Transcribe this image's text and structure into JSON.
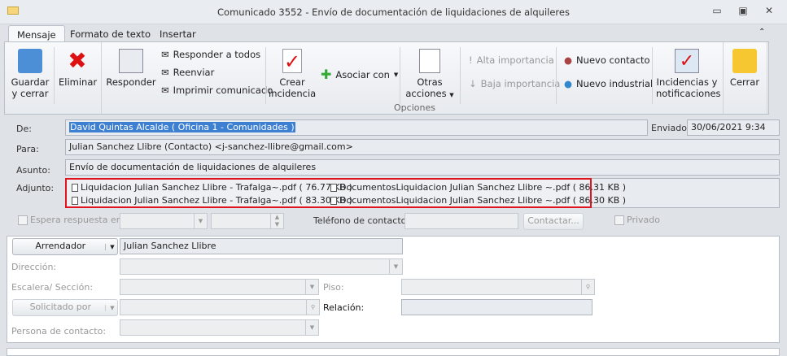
{
  "window": {
    "title": "Comunicado 3552 - Envío de documentación de liquidaciones de alquileres"
  },
  "tabs": [
    "Mensaje",
    "Formato de texto",
    "Insertar"
  ],
  "ribbon": {
    "guardar": "Guardar y cerrar",
    "eliminar": "Eliminar",
    "responder": "Responder",
    "responder_todos": "Responder a todos",
    "reenviar": "Reenviar",
    "imprimir": "Imprimir comunicado",
    "crear_incidencia": "Crear incidencia",
    "asociar": "Asociar con",
    "otras_acciones": "Otras acciones",
    "alta": "Alta importancia",
    "baja": "Baja importancia",
    "nuevo_contacto": "Nuevo contacto",
    "nuevo_industrial": "Nuevo industrial",
    "incidencias": "Incidencias y notificaciones",
    "cerrar": "Cerrar",
    "group_label": "Opciones"
  },
  "form": {
    "de_label": "De:",
    "de_value": "David Quintas Alcalde ( Oficina 1 - Comunidades )",
    "enviado_label": "Enviado:",
    "enviado_value": "30/06/2021 9:34",
    "para_label": "Para:",
    "para_value": "Julian Sanchez Llibre (Contacto) <j-sanchez-llibre@gmail.com>",
    "asunto_label": "Asunto:",
    "asunto_value": "Envío de documentación de liquidaciones de alquileres",
    "adjunto_label": "Adjunto:",
    "attachments": [
      "Liquidacion Julian Sanchez Llibre - Trafalga~.pdf ( 76.77 KB )",
      "DocumentosLiquidacion Julian Sanchez Llibre ~.pdf ( 86.31 KB )",
      "Liquidacion Julian Sanchez Llibre - Trafalga~.pdf ( 83.30 KB )",
      "DocumentosLiquidacion Julian Sanchez Llibre ~.pdf ( 86.30 KB )"
    ],
    "espera_label": "Espera respuesta en:",
    "telefono_label": "Teléfono de contacto:",
    "contactar": "Contactar...",
    "privado": "Privado"
  },
  "lower": {
    "arrendador_btn": "Arrendador",
    "arrendador_value": "Julian Sanchez Llibre",
    "direccion": "Dirección:",
    "escalera": "Escalera/ Sección:",
    "piso": "Piso:",
    "solicitado_btn": "Solicitado por",
    "relacion": "Relación:",
    "persona": "Persona de contacto:"
  },
  "colors": {
    "highlight_border": "#e0141e",
    "selection": "#3d7fd0"
  }
}
